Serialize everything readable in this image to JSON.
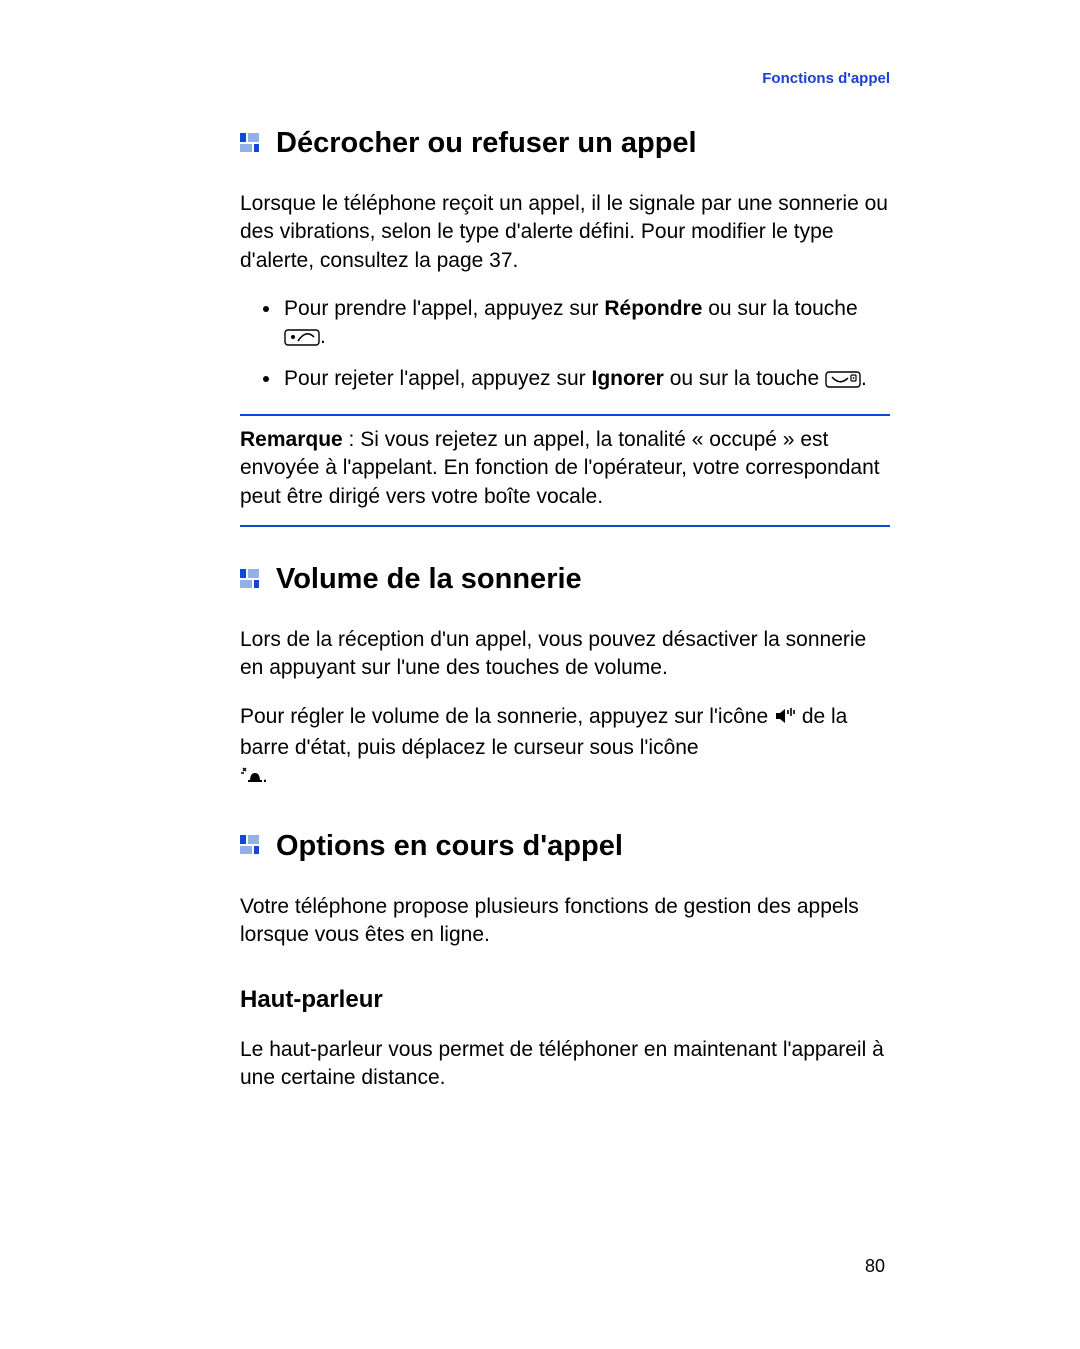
{
  "header_link": "Fonctions d'appel",
  "h1": "Décrocher ou refuser un appel",
  "p1": "Lorsque le téléphone reçoit un appel, il le signale par une sonnerie ou des vibrations, selon le type d'alerte défini. Pour modifier le type d'alerte, consultez la page 37.",
  "li1_a": "Pour prendre l'appel, appuyez sur ",
  "li1_bold": "Répondre",
  "li1_b": " ou sur la touche ",
  "li1_c": ".",
  "li2_a": "Pour rejeter l'appel, appuyez sur ",
  "li2_bold": "Ignorer",
  "li2_b": " ou sur la touche ",
  "li2_c": ".",
  "note_label": "Remarque",
  "note_body": " : Si vous rejetez un appel, la tonalité « occupé » est envoyée à l'appelant. En fonction de l'opérateur, votre correspondant peut être dirigé vers votre boîte vocale.",
  "h2": "Volume de la sonnerie",
  "p2": "Lors de la réception d'un appel, vous pouvez désactiver la sonnerie en appuyant sur l'une des touches de volume.",
  "p3_a": "Pour régler le volume de la sonnerie, appuyez sur l'icône ",
  "p3_b": " de la barre d'état, puis déplacez le curseur sous l'icône ",
  "p3_c": ".",
  "h3": "Options en cours d'appel",
  "p4": "Votre téléphone propose plusieurs fonctions de gestion des appels lorsque vous êtes en ligne.",
  "sub1": "Haut-parleur",
  "p5": "Le haut-parleur vous permet de téléphoner en maintenant l'appareil à une certaine distance.",
  "page_number": "80"
}
